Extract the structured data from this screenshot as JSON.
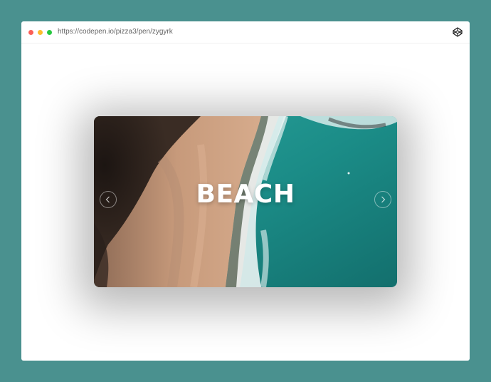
{
  "browser": {
    "url": "https://codepen.io/pizza3/pen/zygyrk",
    "icon": "codepen-icon"
  },
  "slider": {
    "title": "BEACH",
    "prev_icon": "chevron-left-icon",
    "next_icon": "chevron-right-icon"
  },
  "colors": {
    "page_background": "#4a918f",
    "window_background": "#ffffff",
    "sea": "#1f8f8a",
    "sand": "#c89a7c",
    "dark_shore": "#241c18"
  }
}
